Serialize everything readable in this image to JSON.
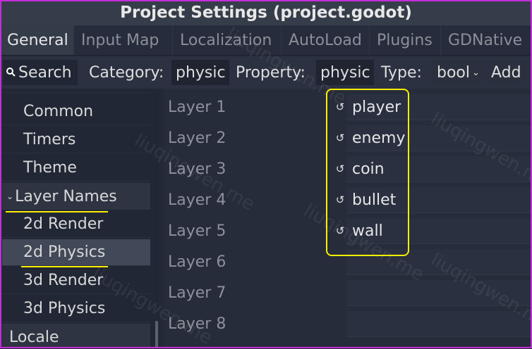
{
  "window": {
    "title": "Project Settings (project.godot)"
  },
  "tabs": [
    "General",
    "Input Map",
    "Localization",
    "AutoLoad",
    "Plugins",
    "GDNative"
  ],
  "toolbar": {
    "search_label": "Search",
    "category_label": "Category:",
    "category_value": "physic",
    "property_label": "Property:",
    "property_value": "physic",
    "type_label": "Type:",
    "type_value": "bool",
    "add_label": "Add"
  },
  "tree": {
    "items": [
      {
        "label": "Common"
      },
      {
        "label": "Timers"
      },
      {
        "label": "Theme"
      },
      {
        "label": "Layer Names"
      },
      {
        "label": "2d Render"
      },
      {
        "label": "2d Physics"
      },
      {
        "label": "3d Render"
      },
      {
        "label": "3d Physics"
      },
      {
        "label": "Locale"
      }
    ]
  },
  "properties": {
    "rows": [
      {
        "label": "Layer 1",
        "value": "player"
      },
      {
        "label": "Layer 2",
        "value": "enemy"
      },
      {
        "label": "Layer 3",
        "value": "coin"
      },
      {
        "label": "Layer 4",
        "value": "bullet"
      },
      {
        "label": "Layer 5",
        "value": "wall"
      },
      {
        "label": "Layer 6",
        "value": ""
      },
      {
        "label": "Layer 7",
        "value": ""
      },
      {
        "label": "Layer 8",
        "value": ""
      }
    ]
  },
  "watermark": "liuqingwen.me",
  "colors": {
    "highlight": "#ffee00",
    "frame": "#c62ddc",
    "background": "#202531"
  }
}
